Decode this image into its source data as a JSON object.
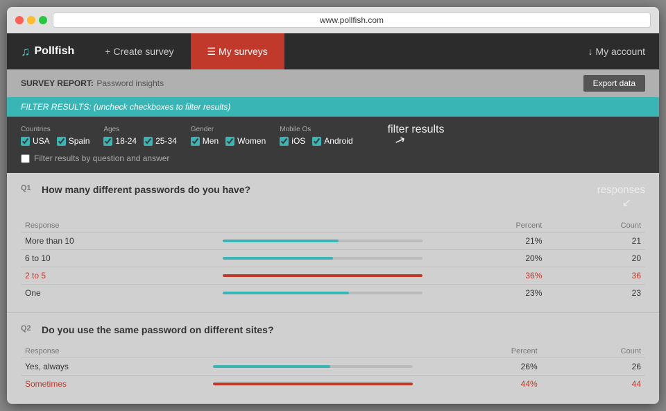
{
  "browser": {
    "url": "www.pollfish.com"
  },
  "nav": {
    "logo": "Pollfish",
    "logo_icon": "♫",
    "create_survey_label": "+ Create survey",
    "my_surveys_label": "☰ My surveys",
    "my_account_label": "↓ My account"
  },
  "survey_report": {
    "label": "SURVEY REPORT:",
    "title": "Password insights",
    "export_label": "Export data"
  },
  "filter": {
    "header": "FILTER RESULTS:",
    "header_note": "(uncheck checkboxes to filter results)",
    "countries_label": "Countries",
    "countries": [
      {
        "id": "usa",
        "label": "USA",
        "checked": true
      },
      {
        "id": "spain",
        "label": "Spain",
        "checked": true
      }
    ],
    "ages_label": "Ages",
    "ages": [
      {
        "id": "18-24",
        "label": "18-24",
        "checked": true
      },
      {
        "id": "25-34",
        "label": "25-34",
        "checked": true
      }
    ],
    "gender_label": "Gender",
    "genders": [
      {
        "id": "men",
        "label": "Men",
        "checked": true
      },
      {
        "id": "women",
        "label": "Women",
        "checked": true
      }
    ],
    "mobile_os_label": "Mobile os",
    "mobile_os": [
      {
        "id": "ios",
        "label": "iOS",
        "checked": true
      },
      {
        "id": "android",
        "label": "Android",
        "checked": true
      }
    ],
    "qa_filter_label": "Filter results by question and answer"
  },
  "questions": [
    {
      "number": "Q1",
      "text": "How many different passwords do you have?",
      "responses_header": "Response",
      "percent_header": "Percent",
      "count_header": "Count",
      "rows": [
        {
          "label": "More than 10",
          "percent": 21,
          "percent_label": "21%",
          "count": 21,
          "highlight": false
        },
        {
          "label": "6 to 10",
          "percent": 20,
          "percent_label": "20%",
          "count": 20,
          "highlight": false
        },
        {
          "label": "2 to 5",
          "percent": 36,
          "percent_label": "36%",
          "count": 36,
          "highlight": true
        },
        {
          "label": "One",
          "percent": 23,
          "percent_label": "23%",
          "count": 23,
          "highlight": false
        }
      ]
    },
    {
      "number": "Q2",
      "text": "Do you use the same password on different sites?",
      "responses_header": "Response",
      "percent_header": "Percent",
      "count_header": "Count",
      "rows": [
        {
          "label": "Yes, always",
          "percent": 26,
          "percent_label": "26%",
          "count": 26,
          "highlight": false
        },
        {
          "label": "Sometimes",
          "percent": 44,
          "percent_label": "44%",
          "count": 44,
          "highlight": true
        }
      ]
    }
  ],
  "annotations": {
    "export_data": "export data",
    "filter_results": "filter results",
    "responses": "responses"
  }
}
